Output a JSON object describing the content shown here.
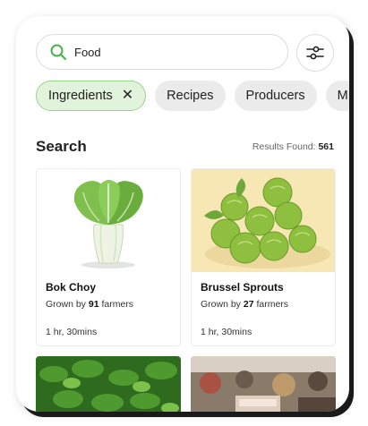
{
  "search": {
    "value": "Food"
  },
  "chips": [
    {
      "label": "Ingredients",
      "close": "✕"
    },
    {
      "label": "Recipes"
    },
    {
      "label": "Producers"
    },
    {
      "label": "M"
    }
  ],
  "section": {
    "title": "Search",
    "results_label": "Results Found:",
    "results_count": "561"
  },
  "cards": [
    {
      "title": "Bok Choy",
      "grown_prefix": "Grown by",
      "farmers": "91",
      "grown_suffix": "farmers",
      "time": "1 hr, 30mins"
    },
    {
      "title": "Brussel Sprouts",
      "grown_prefix": "Grown by",
      "farmers": "27",
      "grown_suffix": "farmers",
      "time": "1 hr, 30mins"
    }
  ],
  "colors": {
    "accent_green": "#4caf50",
    "chip_active_bg": "#e2f3dc"
  }
}
